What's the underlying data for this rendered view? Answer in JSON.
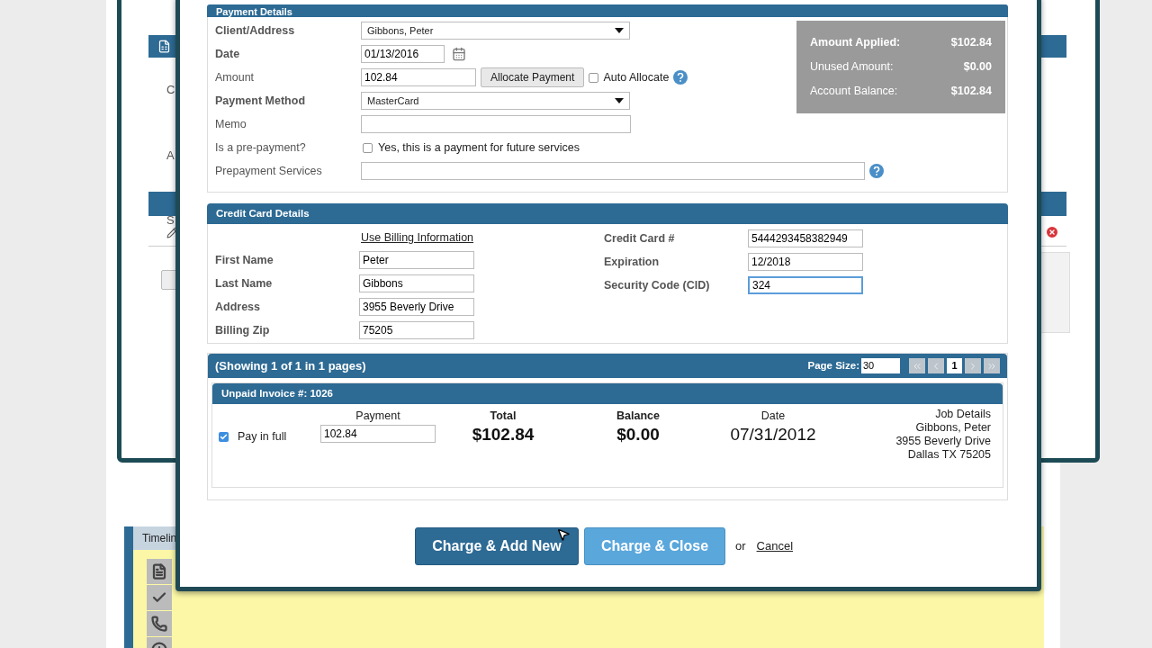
{
  "background": {
    "side_letters": [
      "C",
      "A",
      "S"
    ],
    "timeline_tab": "Timelin"
  },
  "payment_details": {
    "title": "Payment Details",
    "fields": [
      {
        "kind": "select",
        "label": "Client/Address",
        "required": true,
        "value": "Gibbons, Peter"
      },
      {
        "kind": "date",
        "label": "Date",
        "required": true,
        "value": "01/13/2016"
      },
      {
        "kind": "amount",
        "label": "Amount",
        "required": false,
        "value": "102.84",
        "button": "Allocate Payment",
        "option": "Auto Allocate",
        "option_checked": false
      },
      {
        "kind": "select",
        "label": "Payment Method",
        "required": true,
        "value": "MasterCard"
      },
      {
        "kind": "text",
        "label": "Memo",
        "required": false
      },
      {
        "kind": "checkbox",
        "label": "Is a pre-payment?",
        "required": false,
        "option": "Yes, this is a payment for future services",
        "option_checked": false
      },
      {
        "kind": "wide",
        "label": "Prepayment Services",
        "required": false
      }
    ],
    "summary": [
      {
        "label": "Amount Applied:",
        "value": "$102.84",
        "emphasis": true
      },
      {
        "label": "Unused Amount:",
        "value": "$0.00",
        "emphasis": false
      },
      {
        "label": "Account Balance:",
        "value": "$102.84",
        "emphasis": false
      }
    ]
  },
  "credit_card": {
    "title": "Credit Card Details",
    "link": "Use Billing Information",
    "left_fields": [
      {
        "label": "First Name",
        "value": "Peter"
      },
      {
        "label": "Last Name",
        "value": "Gibbons"
      },
      {
        "label": "Address",
        "value": "3955 Beverly Drive"
      },
      {
        "label": "Billing Zip",
        "value": "75205"
      }
    ],
    "right_fields": [
      {
        "label": "Credit Card #",
        "value": "5444293458382949",
        "focused": false
      },
      {
        "label": "Expiration",
        "value": "12/2018",
        "focused": false
      },
      {
        "label": "Security Code (CID)",
        "value": "324",
        "focused": true
      }
    ]
  },
  "pager": {
    "title": "(Showing 1 of 1 in 1 pages)",
    "page_size_label": "Page Size:",
    "page_size": "30",
    "current_page": "1"
  },
  "invoice": {
    "title": "Unpaid Invoice #: 1026",
    "pay_in_full": {
      "label": "Pay in full",
      "checked": true
    },
    "payment_label": "Payment",
    "payment_value": "102.84",
    "columns": [
      {
        "label": "Total",
        "value": "$102.84",
        "bold": true
      },
      {
        "label": "Balance",
        "value": "$0.00",
        "bold": true
      },
      {
        "label": "Date",
        "value": "07/31/2012",
        "bold": false
      }
    ],
    "job_details": [
      "Job Details",
      "Gibbons, Peter",
      "3955 Beverly Drive",
      "Dallas TX 75205"
    ]
  },
  "actions": {
    "primary": "Charge & Add New",
    "secondary": "Charge & Close",
    "separator": "or",
    "cancel": "Cancel"
  }
}
